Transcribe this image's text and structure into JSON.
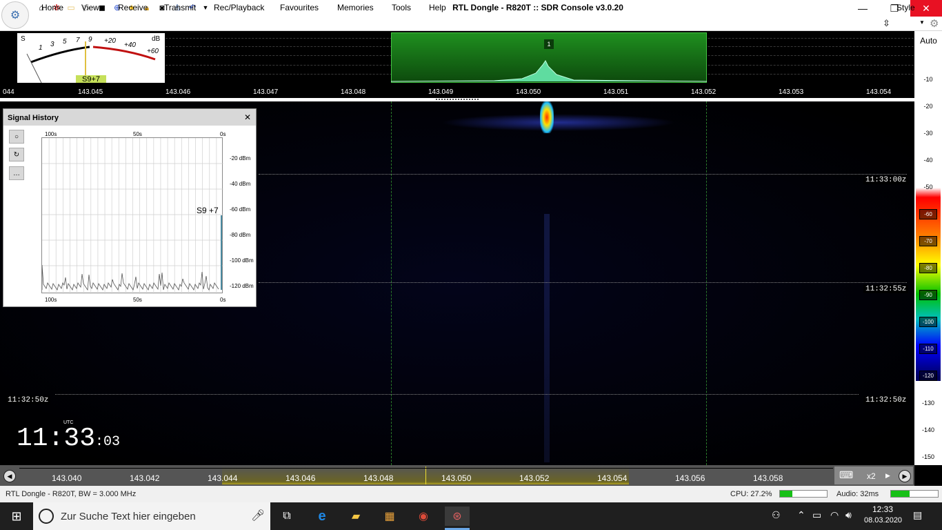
{
  "window": {
    "title": "RTL Dongle - R820T :: SDR Console v3.0.20",
    "minimize": "—",
    "restore": "❐",
    "close": "✕"
  },
  "quick_access": [
    "home-icon",
    "settings-icon",
    "folder-icon",
    "play-icon",
    "stop-icon",
    "add-icon",
    "favourite-icon",
    "lock-icon",
    "camera-icon",
    "antenna-icon",
    "undo-icon",
    "dropdown-icon"
  ],
  "menu": {
    "items": [
      "Home",
      "View",
      "Receive",
      "Transmit",
      "Rec/Playback",
      "Favourites",
      "Memories",
      "Tools",
      "Help"
    ],
    "style": "Style"
  },
  "smeter": {
    "s_label": "S",
    "db_label": "dB",
    "s_scale": [
      "1",
      "3",
      "5",
      "7",
      "9"
    ],
    "db_scale": [
      "+20",
      "+40",
      "+60"
    ],
    "reading": "S9+7"
  },
  "filter": {
    "label": "1"
  },
  "top_frequencies": [
    "044",
    "143.045",
    "143.046",
    "143.047",
    "143.048",
    "143.049",
    "143.050",
    "143.051",
    "143.052",
    "143.053",
    "143.054"
  ],
  "waterfall": {
    "timestamps_right": [
      "11:33:00z",
      "11:32:55z",
      "11:32:50z"
    ],
    "timestamp_left": "11:32:50z"
  },
  "db_scale": {
    "auto": "Auto",
    "labels": [
      "-10",
      "-20",
      "-30",
      "-40",
      "-50",
      "-60",
      "-70",
      "-80",
      "-90",
      "-100",
      "-110",
      "-120",
      "-130",
      "-140",
      "-150"
    ]
  },
  "signal_history": {
    "title": "Signal History",
    "close": "✕",
    "x_top": [
      "100s",
      "50s",
      "0s"
    ],
    "x_bottom": [
      "100s",
      "50s",
      "0s"
    ],
    "y_labels": [
      "-20 dBm",
      "-40 dBm",
      "-60 dBm",
      "-80 dBm",
      "-100 dBm",
      "-120 dBm"
    ],
    "current": "S9 +7",
    "tools": [
      "○",
      "↻",
      "…"
    ]
  },
  "clock": {
    "utc": "UTC",
    "hm": "11:33",
    "sec": ":03"
  },
  "bottom_ruler": {
    "labels": [
      "143.040",
      "143.042",
      "143.044",
      "143.046",
      "143.048",
      "143.050",
      "143.052",
      "143.054",
      "143.056",
      "143.058"
    ],
    "zoom": "x2"
  },
  "status": {
    "device": "RTL Dongle - R820T, BW = 3.000 MHz",
    "cpu": "CPU: 27.2%",
    "cpu_level": 0.27,
    "audio": "Audio: 32ms",
    "audio_level": 0.4
  },
  "taskbar": {
    "search_placeholder": "Zur Suche Text hier eingeben",
    "time": "12:33",
    "date": "08.03.2020"
  }
}
